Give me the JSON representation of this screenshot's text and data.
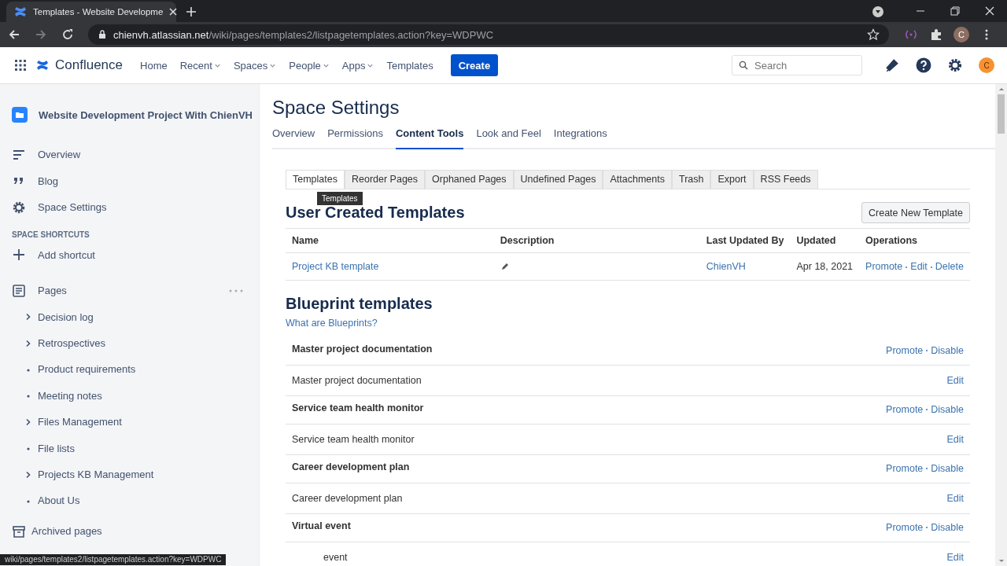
{
  "browser": {
    "tab_title": "Templates - Website Developme",
    "url_host": "chienvh.atlassian.net",
    "url_path": "/wiki/pages/templates2/listpagetemplates.action?key=WDPWC",
    "profile_initial": "C"
  },
  "header": {
    "logo": "Confluence",
    "nav": [
      {
        "label": "Home",
        "dropdown": false
      },
      {
        "label": "Recent",
        "dropdown": true
      },
      {
        "label": "Spaces",
        "dropdown": true
      },
      {
        "label": "People",
        "dropdown": true
      },
      {
        "label": "Apps",
        "dropdown": true
      },
      {
        "label": "Templates",
        "dropdown": false
      }
    ],
    "create": "Create",
    "search": {
      "placeholder": "Search"
    },
    "avatar": "C"
  },
  "sidebar": {
    "space_title": "Website Development Project With ChienVH",
    "items": [
      {
        "label": "Overview",
        "kind": "overview"
      },
      {
        "label": "Blog",
        "kind": "blog"
      },
      {
        "label": "Space Settings",
        "kind": "settings"
      }
    ],
    "shortcuts_heading": "SPACE SHORTCUTS",
    "add_shortcut": "Add shortcut",
    "pages_label": "Pages",
    "pages": [
      {
        "label": "Decision log",
        "kind": "branch"
      },
      {
        "label": "Retrospectives",
        "kind": "branch"
      },
      {
        "label": "Product requirements",
        "kind": "leaf"
      },
      {
        "label": "Meeting notes",
        "kind": "leaf"
      },
      {
        "label": "Files Management",
        "kind": "branch"
      },
      {
        "label": "File lists",
        "kind": "leaf"
      },
      {
        "label": "Projects KB Management",
        "kind": "branch"
      },
      {
        "label": "About Us",
        "kind": "leaf"
      }
    ],
    "archived": "Archived pages"
  },
  "main": {
    "title": "Space Settings",
    "tabs": [
      {
        "label": "Overview",
        "selected": false
      },
      {
        "label": "Permissions",
        "selected": false
      },
      {
        "label": "Content Tools",
        "selected": true
      },
      {
        "label": "Look and Feel",
        "selected": false
      },
      {
        "label": "Integrations",
        "selected": false
      }
    ],
    "subtabs": [
      {
        "label": "Templates",
        "selected": true
      },
      {
        "label": "Reorder Pages",
        "selected": false
      },
      {
        "label": "Orphaned Pages",
        "selected": false
      },
      {
        "label": "Undefined Pages",
        "selected": false
      },
      {
        "label": "Attachments",
        "selected": false
      },
      {
        "label": "Trash",
        "selected": false
      },
      {
        "label": "Export",
        "selected": false
      },
      {
        "label": "RSS Feeds",
        "selected": false
      }
    ],
    "tooltip": "Templates",
    "user_templates": {
      "heading": "User Created Templates",
      "create_button": "Create New Template",
      "columns": [
        "Name",
        "Description",
        "Last Updated By",
        "Updated",
        "Operations"
      ],
      "rows": [
        {
          "name": "Project KB template",
          "updated_by": "ChienVH",
          "updated": "Apr 18, 2021",
          "operations": [
            "Promote",
            "Edit",
            "Delete"
          ]
        }
      ]
    },
    "blueprints": {
      "heading": "Blueprint templates",
      "help_link": "What are Blueprints?",
      "groups": [
        {
          "title": "Master project documentation",
          "actions": [
            "Promote",
            "Disable"
          ],
          "template": "Master project documentation",
          "template_action": "Edit"
        },
        {
          "title": "Service team health monitor",
          "actions": [
            "Promote",
            "Disable"
          ],
          "template": "Service team health monitor",
          "template_action": "Edit"
        },
        {
          "title": "Career development plan",
          "actions": [
            "Promote",
            "Disable"
          ],
          "template": "Career development plan",
          "template_action": "Edit"
        },
        {
          "title": "Virtual event",
          "actions": [
            "Promote",
            "Disable"
          ],
          "template": "event",
          "template_action": "Edit"
        }
      ]
    }
  },
  "status_bar": "wiki/pages/templates2/listpagetemplates.action?key=WDPWC"
}
